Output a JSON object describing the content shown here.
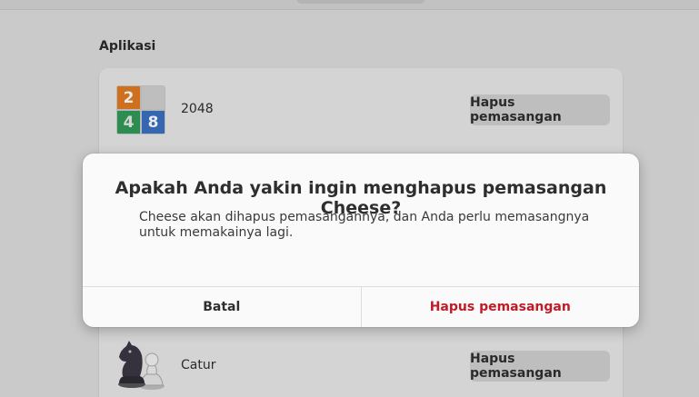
{
  "section": {
    "title": "Aplikasi"
  },
  "apps": [
    {
      "name": "2048",
      "icon": "2048-icon",
      "tiles": [
        "2",
        "",
        "4",
        "8"
      ],
      "action_label": "Hapus pemasangan"
    },
    {
      "name": "Catur",
      "icon": "chess-icon",
      "action_label": "Hapus pemasangan"
    }
  ],
  "dialog": {
    "heading": "Apakah Anda yakin ingin menghapus pemasangan Cheese?",
    "body": "Cheese akan dihapus pemasangannya, dan Anda perlu memasangnya untuk memakainya lagi.",
    "cancel_label": "Batal",
    "confirm_label": "Hapus pemasangan"
  },
  "colors": {
    "destructive": "#c01c28",
    "tile_orange": "#e07a20",
    "tile_green": "#2f9a57",
    "tile_blue": "#3a6fc0"
  }
}
